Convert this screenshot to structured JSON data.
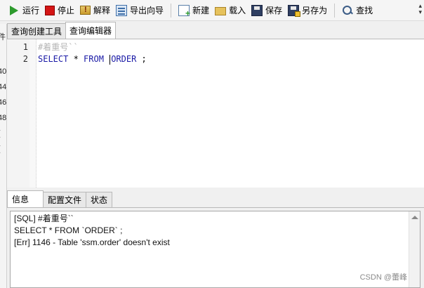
{
  "toolbar": {
    "run": "运行",
    "stop": "停止",
    "explain": "解释",
    "export_wizard": "导出向导",
    "new": "新建",
    "load": "载入",
    "save": "保存",
    "save_as": "另存为",
    "find": "查找"
  },
  "tabs": {
    "query_builder": "查询创建工具",
    "query_editor": "查询编辑器"
  },
  "left_panel": {
    "items": [
      "件",
      "40",
      "44",
      "46",
      "48",
      "(",
      "("
    ]
  },
  "editor": {
    "lines": [
      {
        "number": "1",
        "text": "#着重号``"
      },
      {
        "number": "2",
        "kw_select": "SELECT",
        "star": " * ",
        "kw_from": "FROM",
        "table_before_caret": " ",
        "table": "ORDER",
        "end": " ;"
      }
    ]
  },
  "bottom_tabs": {
    "info": "信息",
    "profile": "配置文件",
    "status": "状态"
  },
  "output": {
    "lines": [
      "[SQL] #着重号``",
      "SELECT * FROM `ORDER` ;",
      "[Err] 1146 - Table 'ssm.order' doesn't exist"
    ],
    "watermark": "CSDN @蕾峰"
  }
}
